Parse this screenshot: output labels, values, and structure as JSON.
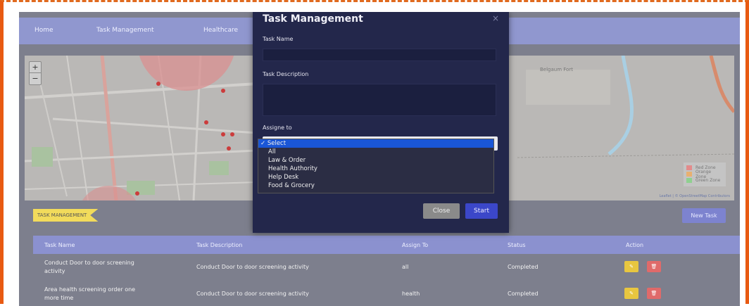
{
  "nav": {
    "items": [
      {
        "label": "Home"
      },
      {
        "label": "Task Management"
      },
      {
        "label": "Healthcare"
      }
    ]
  },
  "map": {
    "zoom_in": "+",
    "zoom_out": "−",
    "legend": [
      {
        "label": "Red Zone",
        "color": "#e38b8b"
      },
      {
        "label": "Orange Zone",
        "color": "#e8b070"
      },
      {
        "label": "Green Zone",
        "color": "#8fd08f"
      }
    ],
    "place_label": "Belgaum Fort",
    "attribution": "Leaflet | © OpenStreetMap Contributors"
  },
  "tasks": {
    "section_tag": "TASK MANAGEMENT",
    "new_task_label": "New Task",
    "columns": [
      "Task Name",
      "Task Description",
      "Assign To",
      "Status",
      "Action"
    ],
    "rows": [
      {
        "name_line1": "Conduct Door to door screening",
        "name_line2": "activity",
        "description": "Conduct Door to door screening activity",
        "assign": "all",
        "status": "Completed"
      },
      {
        "name_line1": "Area health screening order one",
        "name_line2": "more time",
        "description": "Conduct Door to door screening activity",
        "assign": "health",
        "status": "Completed"
      }
    ]
  },
  "modal": {
    "title": "Task Management",
    "close_icon": "×",
    "task_name_label": "Task Name",
    "task_description_label": "Task Description",
    "assign_label": "Assigne to",
    "options": [
      "Select",
      "All",
      "Law & Order",
      "Health Authority",
      "Help Desk",
      "Food & Grocery"
    ],
    "selected_option": "Select",
    "close_button": "Close",
    "start_button": "Start"
  }
}
